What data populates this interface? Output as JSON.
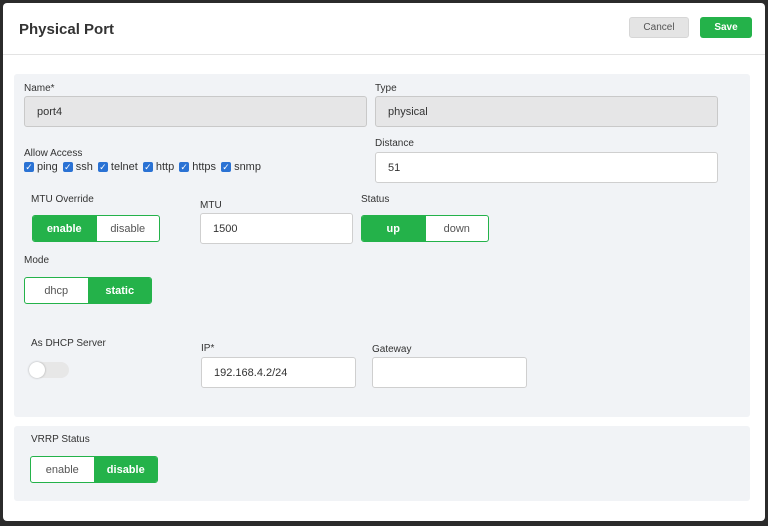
{
  "header": {
    "title": "Physical Port",
    "cancel_label": "Cancel",
    "save_label": "Save"
  },
  "form": {
    "name": {
      "label": "Name*",
      "value": "port4"
    },
    "type": {
      "label": "Type",
      "value": "physical"
    },
    "allow_access": {
      "label": "Allow Access",
      "options": [
        {
          "label": "ping",
          "checked": true
        },
        {
          "label": "ssh",
          "checked": true
        },
        {
          "label": "telnet",
          "checked": true
        },
        {
          "label": "http",
          "checked": true
        },
        {
          "label": "https",
          "checked": true
        },
        {
          "label": "snmp",
          "checked": true
        }
      ]
    },
    "distance": {
      "label": "Distance",
      "value": "51"
    },
    "mtu_override": {
      "label": "MTU Override",
      "options": [
        "enable",
        "disable"
      ],
      "selected": "enable"
    },
    "mtu": {
      "label": "MTU",
      "value": "1500"
    },
    "status": {
      "label": "Status",
      "options": [
        "up",
        "down"
      ],
      "selected": "up"
    },
    "mode": {
      "label": "Mode",
      "options": [
        "dhcp",
        "static"
      ],
      "selected": "static"
    },
    "dhcp_server": {
      "label": "As DHCP Server",
      "enabled": false
    },
    "ip": {
      "label": "IP*",
      "value": "192.168.4.2/24"
    },
    "gateway": {
      "label": "Gateway",
      "value": ""
    }
  },
  "vrrp": {
    "label": "VRRP Status",
    "options": [
      "enable",
      "disable"
    ],
    "selected": "disable"
  },
  "colors": {
    "accent": "#24b24a",
    "checkbox": "#2a72d4",
    "panel": "#f1f3f6"
  }
}
